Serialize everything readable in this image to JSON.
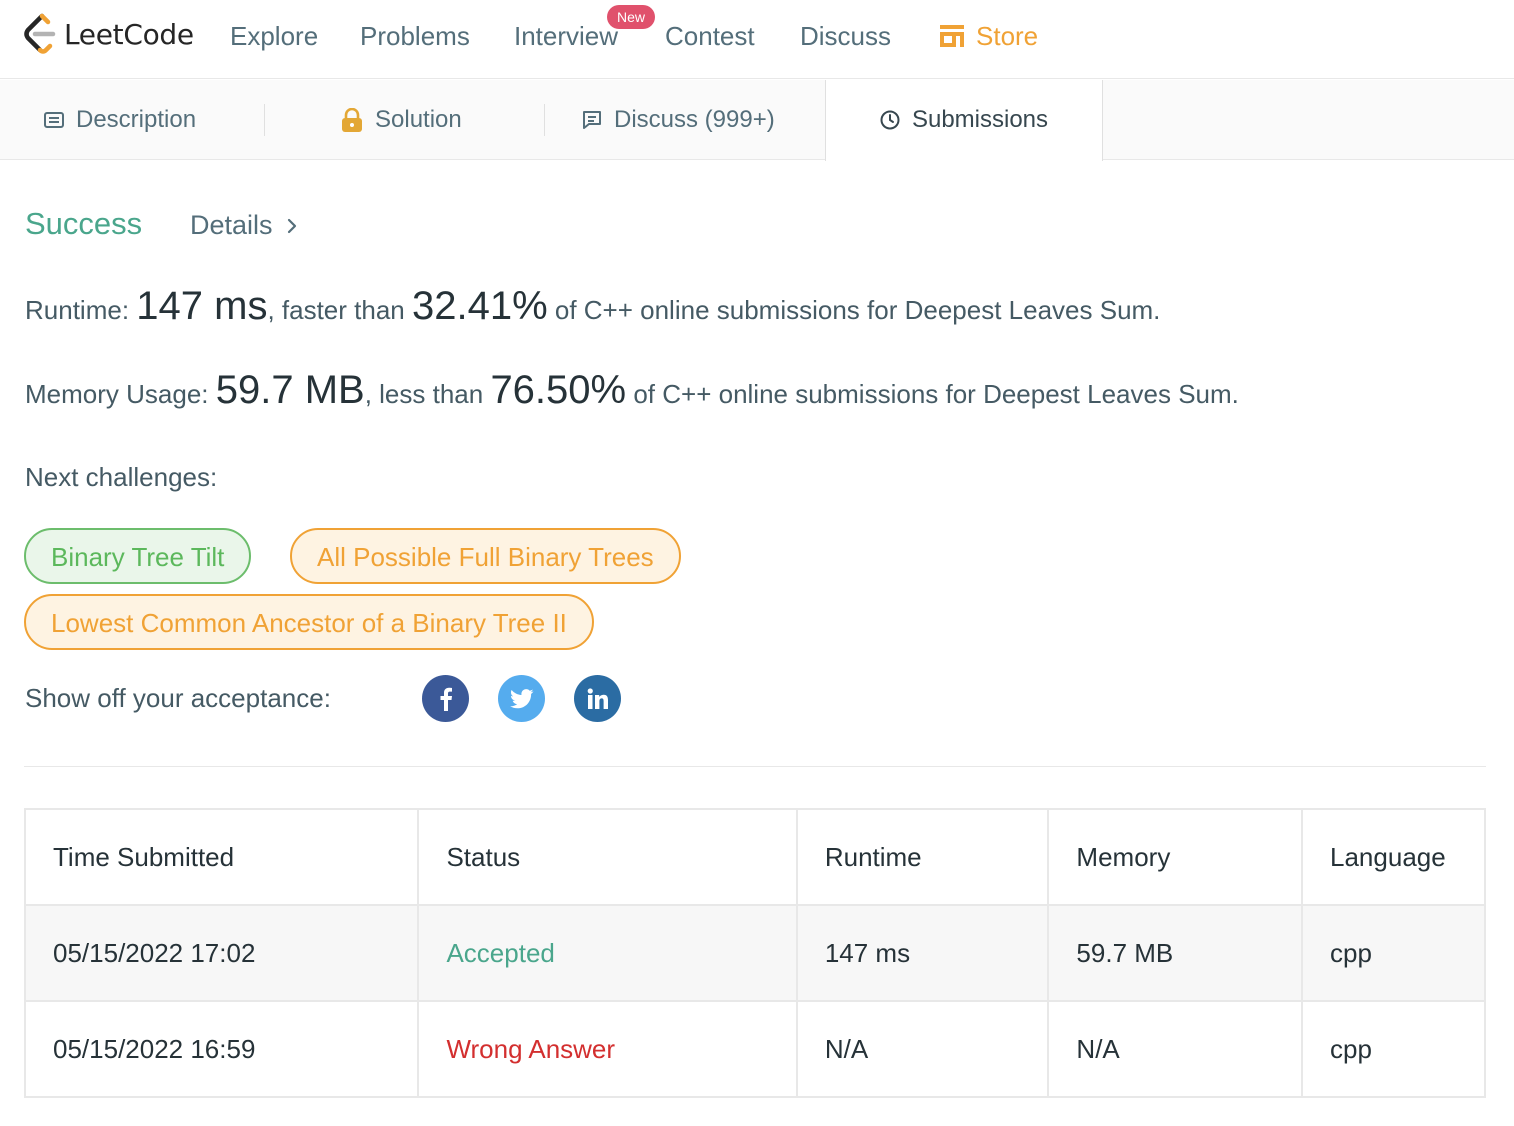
{
  "nav": {
    "logo_text": "LeetCode",
    "items": [
      "Explore",
      "Problems",
      "Interview",
      "Contest",
      "Discuss"
    ],
    "badge": "New",
    "store": "Store"
  },
  "tabs": {
    "description": "Description",
    "solution": "Solution",
    "discuss": "Discuss (999+)",
    "submissions": "Submissions"
  },
  "result": {
    "status": "Success",
    "details": "Details",
    "runtime_label": "Runtime: ",
    "runtime_value": "147 ms",
    "runtime_mid": ", faster than ",
    "runtime_pct": "32.41%",
    "runtime_tail": " of C++ online submissions for Deepest Leaves Sum.",
    "memory_label": "Memory Usage: ",
    "memory_value": "59.7 MB",
    "memory_mid": ", less than ",
    "memory_pct": "76.50%",
    "memory_tail": " of C++ online submissions for Deepest Leaves Sum.",
    "next_label": "Next challenges:",
    "challenges": [
      "Binary Tree Tilt",
      "All Possible Full Binary Trees",
      "Lowest Common Ancestor of a Binary Tree II"
    ],
    "share_label": "Show off your acceptance:"
  },
  "table": {
    "headers": [
      "Time Submitted",
      "Status",
      "Runtime",
      "Memory",
      "Language"
    ],
    "rows": [
      {
        "time": "05/15/2022 17:02",
        "status": "Accepted",
        "runtime": "147 ms",
        "memory": "59.7 MB",
        "language": "cpp"
      },
      {
        "time": "05/15/2022 16:59",
        "status": "Wrong Answer",
        "runtime": "N/A",
        "memory": "N/A",
        "language": "cpp"
      }
    ]
  },
  "colors": {
    "accent_green": "#4aa68c",
    "error_red": "#d32f2f",
    "store_orange": "#f0a235",
    "badge_pink": "#e0516c",
    "easy_green": "#5cb85c",
    "facebook": "#3b5998",
    "twitter": "#55acee",
    "linkedin": "#2b6ca3"
  }
}
